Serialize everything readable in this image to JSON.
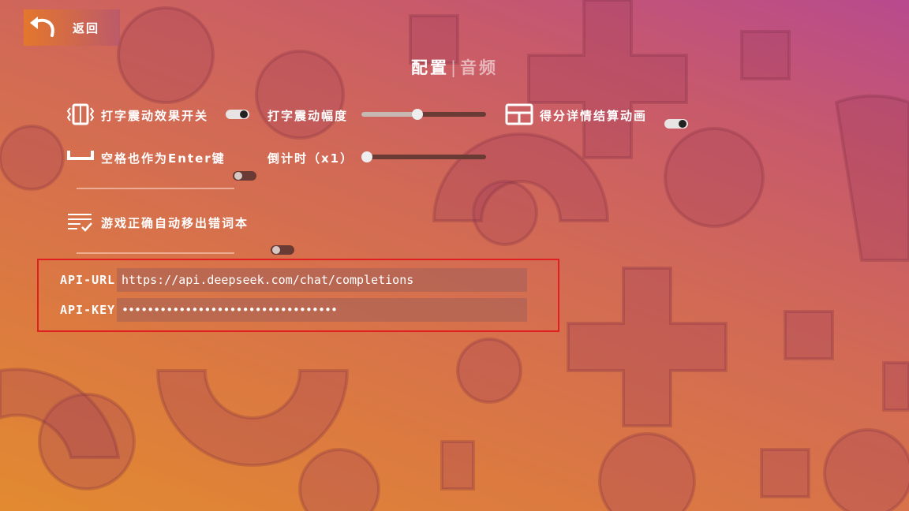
{
  "header": {
    "back_label": "返回",
    "title_active": "配置",
    "title_separator": "|",
    "title_inactive": "音频"
  },
  "settings": {
    "typing_vibration_label": "打字震动效果开关",
    "typing_vibration_on": true,
    "vibration_amplitude_label": "打字震动幅度",
    "vibration_amplitude_value": 0.45,
    "score_detail_anim_label": "得分详情结算动画",
    "score_detail_anim_on": true,
    "space_as_enter_label": "空格也作为Enter键",
    "space_as_enter_on": false,
    "countdown_label": "倒计时（x1）",
    "countdown_value": 0.0,
    "auto_remove_mistakes_label": "游戏正确自动移出错词本",
    "auto_remove_mistakes_on": false
  },
  "api": {
    "url_label": "API-URL",
    "url_value": "https://api.deepseek.com/chat/completions",
    "key_label": "API-KEY",
    "key_value": "••••••••••••••••••••••••••••••••••"
  },
  "icons": {
    "back": "undo-arrow-icon",
    "vibration": "phone-vibrate-icon",
    "layout": "layout-panel-icon",
    "space": "space-bar-icon",
    "list_check": "list-check-icon"
  },
  "colors": {
    "highlight_border": "#e02020"
  }
}
